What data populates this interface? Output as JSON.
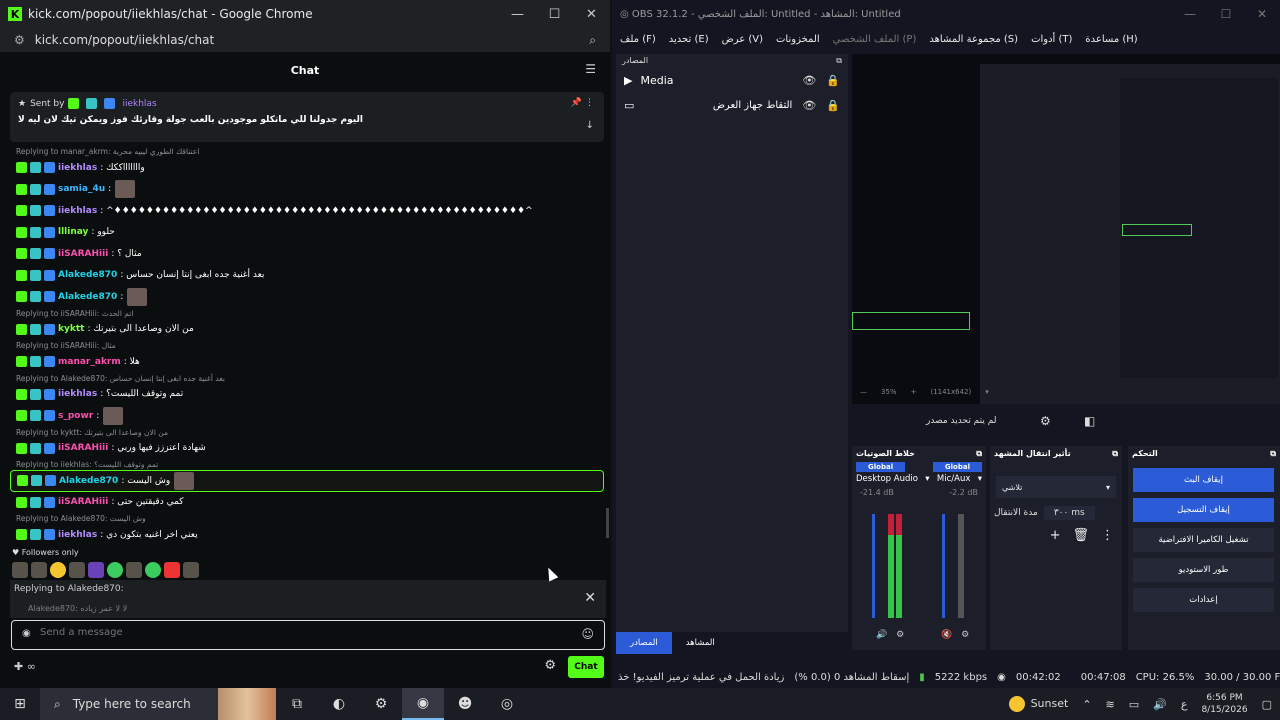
{
  "chrome": {
    "title": "kick.com/popout/iiekhlas/chat - Google Chrome",
    "url": "kick.com/popout/iiekhlas/chat"
  },
  "kick": {
    "header": "Chat",
    "pinned": {
      "sent_by": "Sent by",
      "user": "iiekhlas",
      "message": "اليوم جدولنا للي ماتكلو موجودين بالعب جولة وقارئك فوز ويمكن تيك لان ليه لا"
    },
    "messages": [
      {
        "kind": "reply",
        "text": "Replying to manar_akrm: اعتناقك الطوري ليبيه محرية"
      },
      {
        "kind": "msg",
        "user": "iiekhlas",
        "ucolor": "u-purple",
        "text": ": واااااااككك"
      },
      {
        "kind": "msg",
        "user": "samia_4u",
        "ucolor": "u-blue",
        "text": ":",
        "avatar": true
      },
      {
        "kind": "msg",
        "user": "iiekhlas",
        "ucolor": "u-purple",
        "text": ": ^♦♦♦♦♦♦♦♦♦♦♦♦♦♦♦♦♦♦♦♦♦♦♦♦♦♦♦♦♦♦♦♦♦♦♦♦♦♦♦♦♦♦♦♦♦♦♦♦♦♦♦^"
      },
      {
        "kind": "msg",
        "user": "lllinay",
        "ucolor": "u-green",
        "text": ": حلوو"
      },
      {
        "kind": "msg",
        "user": "iiSARAHiii",
        "ucolor": "u-pink",
        "text": ": مثال ؟"
      },
      {
        "kind": "msg",
        "user": "Alakede870",
        "ucolor": "u-cyan",
        "text": ": بعد أغنية جده ابغى إنتا إنسان حساس"
      },
      {
        "kind": "msg",
        "user": "Alakede870",
        "ucolor": "u-cyan",
        "text": ":",
        "avatar": true
      },
      {
        "kind": "reply",
        "text": "Replying to iiSARAHiii: اتم الحدث"
      },
      {
        "kind": "msg",
        "user": "kyktt",
        "ucolor": "u-green",
        "text": ": من الان وصاعدا الى بتيرتك"
      },
      {
        "kind": "reply",
        "text": "Replying to iiSARAHiii: مثال"
      },
      {
        "kind": "msg",
        "user": "manar_akrm",
        "ucolor": "u-pink",
        "text": ": هلا"
      },
      {
        "kind": "reply",
        "text": "Replying to Alakede870: بعد أغنية جده ابغى إنتا إنسان حساس"
      },
      {
        "kind": "msg",
        "user": "iiekhlas",
        "ucolor": "u-purple",
        "text": ": تمم وتوقف الليست؟"
      },
      {
        "kind": "msg",
        "user": "s_powr",
        "ucolor": "u-pink",
        "text": ":",
        "avatar": true
      },
      {
        "kind": "reply",
        "text": "Replying to kyktt: من الان وصاعدا الى بتيرتك"
      },
      {
        "kind": "msg",
        "user": "iiSARAHiii",
        "ucolor": "u-pink",
        "text": ": شهادة اعتززز فيها وربي"
      },
      {
        "kind": "reply",
        "text": "Replying to iiekhlas: تمم وتوقف الليست؟"
      },
      {
        "kind": "msg",
        "user": "Alakede870",
        "ucolor": "u-cyan",
        "text": ": وش اليست",
        "avatar": true,
        "highlight": true
      },
      {
        "kind": "msg",
        "user": "iiSARAHiii",
        "ucolor": "u-pink",
        "text": ": كمي دقيقتين حتى"
      },
      {
        "kind": "reply",
        "text": "Replying to Alakede870: وش اليست"
      },
      {
        "kind": "msg",
        "user": "iiekhlas",
        "ucolor": "u-purple",
        "text": ": يعني اخر اغنيه بتكون دي"
      }
    ],
    "followers_only": "Followers only",
    "reply_to": "Replying to Alakede870:",
    "reply_quote": "Alakede870: لا لا عمر زياده",
    "input_placeholder": "Send a message",
    "send_label": "Chat"
  },
  "obs": {
    "title": "OBS 32.1.2 - الملف الشخصي: Untitled - المشاهد: Untitled",
    "menu": [
      "ملف (F)",
      "تحديد (E)",
      "عرض (V)",
      "المخزونات",
      "الملف الشخصي (P)",
      "مجموعة المشاهد (S)",
      "أدوات (T)",
      "مساعدة (H)"
    ],
    "sources_header": "المصادر",
    "sources": [
      {
        "name": "Media",
        "icon": "play-icon"
      },
      {
        "name": "التقاط جهاز العرض",
        "icon": "monitor-icon"
      }
    ],
    "preview_zoom": "35%",
    "preview_res": "(1141x642)",
    "no_source": "لم يتم تحديد مصدر",
    "mixer": {
      "title": "خلاط الصوتيات",
      "channels": [
        {
          "tag": "Global",
          "name": "Desktop Audio",
          "db": "-21.4 dB"
        },
        {
          "tag": "Global",
          "name": "Mic/Aux",
          "db": "-2.2 dB"
        }
      ]
    },
    "transitions": {
      "title": "تأثير انتقال المشهد",
      "selected": "تلاشي",
      "duration_label": "مدة الانتقال",
      "duration_value": "٣٠٠ ms"
    },
    "controls": {
      "title": "التحكم",
      "buttons": [
        "إيقاف البث",
        "إيقاف التسجيل",
        "تشغيل الكاميرا الافتراضية",
        "طور الاستوديو",
        "إعدادات"
      ]
    },
    "dock_tabs": [
      "المصادر",
      "المشاهد"
    ],
    "status": {
      "dropped": "إسقاط المشاهد 0 (0.0 %)",
      "encoding": "زيادة الحمل في عملية ترميز الفيديو! خذ",
      "bitrate": "5222 kbps",
      "stream_time": "00:42:02",
      "rec_time": "00:47:08",
      "cpu": "CPU: 26.5%",
      "fps": "30.00 / 30.00 FPS"
    }
  },
  "taskbar": {
    "search_placeholder": "Type here to search",
    "weather": "Sunset",
    "time": "6:56 PM",
    "date": "8/15/2026"
  }
}
